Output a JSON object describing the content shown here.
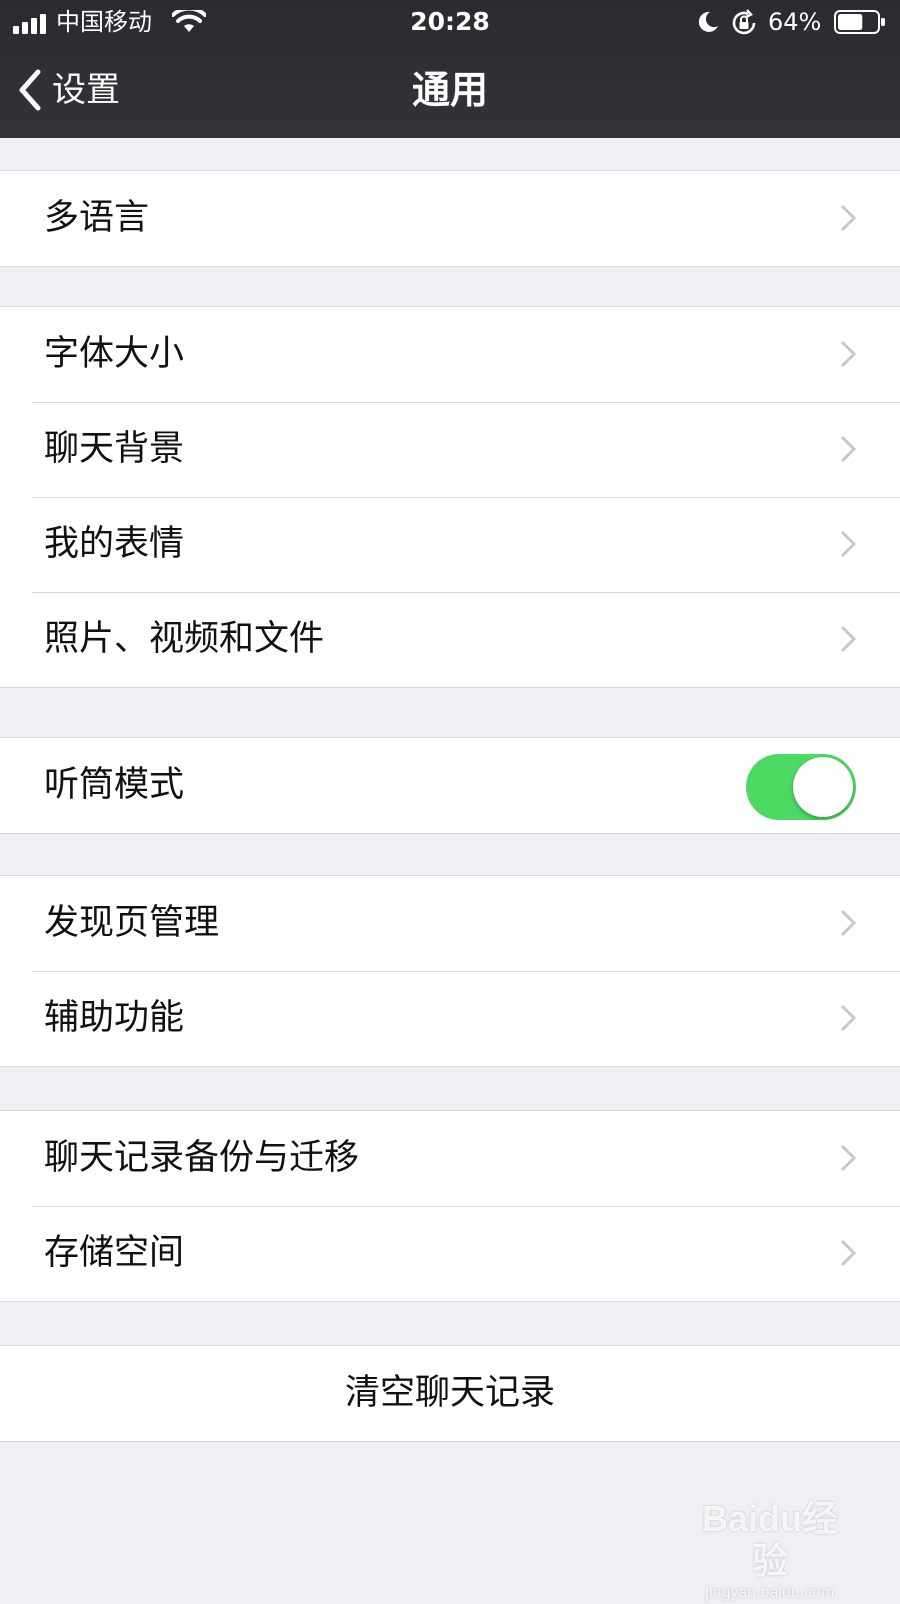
{
  "status_bar": {
    "carrier": "中国移动",
    "time": "20:28",
    "battery_percent": "64%",
    "battery_level": 0.64,
    "icons": [
      "signal-icon",
      "wifi-icon",
      "moon-icon",
      "rotation-lock-icon",
      "battery-icon"
    ]
  },
  "nav": {
    "back_label": "设置",
    "title": "通用"
  },
  "groups": [
    {
      "items": [
        {
          "label": "多语言",
          "accessory": "chevron"
        }
      ]
    },
    {
      "items": [
        {
          "label": "字体大小",
          "accessory": "chevron"
        },
        {
          "label": "聊天背景",
          "accessory": "chevron"
        },
        {
          "label": "我的表情",
          "accessory": "chevron"
        },
        {
          "label": "照片、视频和文件",
          "accessory": "chevron"
        }
      ]
    },
    {
      "items": [
        {
          "label": "听筒模式",
          "accessory": "toggle",
          "toggle_on": true
        }
      ]
    },
    {
      "items": [
        {
          "label": "发现页管理",
          "accessory": "chevron"
        },
        {
          "label": "辅助功能",
          "accessory": "chevron"
        }
      ]
    },
    {
      "items": [
        {
          "label": "聊天记录备份与迁移",
          "accessory": "chevron"
        },
        {
          "label": "存储空间",
          "accessory": "chevron"
        }
      ]
    }
  ],
  "clear_button": {
    "label": "清空聊天记录"
  },
  "watermark": {
    "main": "Baidu经验",
    "sub": "jingyan.baidu.com"
  },
  "colors": {
    "header_bg": "#2e2e32",
    "page_bg": "#efeff4",
    "toggle_on": "#4cd964",
    "chevron": "#c7c7cc"
  }
}
